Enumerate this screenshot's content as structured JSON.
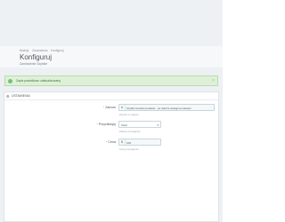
{
  "breadcrumb": [
    "Moduły",
    "Zamówienia",
    "Konfiguruj"
  ],
  "header": {
    "title": "Konfiguruj",
    "subtitle": "Zamówienie Szybkie"
  },
  "alert": {
    "text": "Zapis prawidłowo zaktualizowany",
    "close": "×",
    "color": "#dff0d8"
  },
  "panel": {
    "heading": "Ustawienia",
    "fields": [
      {
        "label": "Zamów",
        "required": "*",
        "addon": "A",
        "value": "Szybki zamówi produktu - po dobrze dostępne tekstem",
        "help": "Zamów w zajęcie"
      },
      {
        "label": "Przyciśnięty",
        "required": "*",
        "value": "Tekst",
        "caret": "▾",
        "help": "Zakres przystępnie"
      },
      {
        "label": "Cena",
        "required": "*",
        "addon": "$",
        "value": "100",
        "help": "Cena przystępnie"
      }
    ]
  }
}
